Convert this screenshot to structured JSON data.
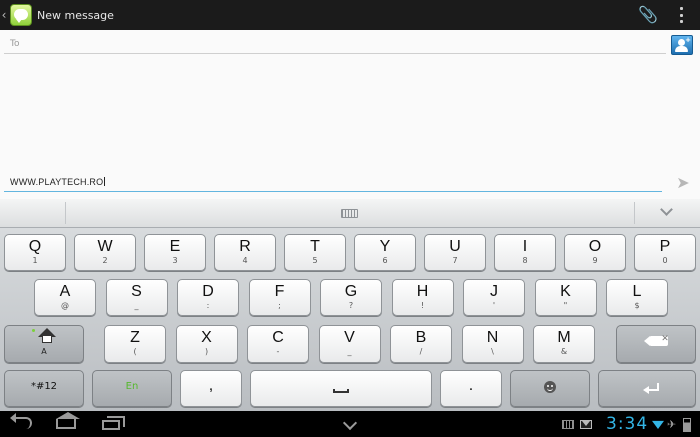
{
  "actionbar": {
    "title": "New message",
    "back_glyph": "‹",
    "app_icon": "messaging-app-icon",
    "attach_icon": "paperclip-icon",
    "overflow_icon": "overflow-menu-icon"
  },
  "compose": {
    "to_placeholder": "To",
    "message_text": "WWW.PLAYTECH.RO",
    "contact_icon": "add-contact-icon",
    "send_icon": "send-icon",
    "accent": "#63b5df"
  },
  "keyboard": {
    "row1": [
      {
        "k": "Q",
        "s": "1"
      },
      {
        "k": "W",
        "s": "2"
      },
      {
        "k": "E",
        "s": "3"
      },
      {
        "k": "R",
        "s": "4"
      },
      {
        "k": "T",
        "s": "5"
      },
      {
        "k": "Y",
        "s": "6"
      },
      {
        "k": "U",
        "s": "7"
      },
      {
        "k": "I",
        "s": "8"
      },
      {
        "k": "O",
        "s": "9"
      },
      {
        "k": "P",
        "s": "0"
      }
    ],
    "row2": [
      {
        "k": "A",
        "s": "@"
      },
      {
        "k": "S",
        "s": "_"
      },
      {
        "k": "D",
        "s": ":"
      },
      {
        "k": "F",
        "s": ";"
      },
      {
        "k": "G",
        "s": "?"
      },
      {
        "k": "H",
        "s": "!"
      },
      {
        "k": "J",
        "s": "'"
      },
      {
        "k": "K",
        "s": "\""
      },
      {
        "k": "L",
        "s": "$"
      }
    ],
    "row3": [
      {
        "k": "Z",
        "s": "("
      },
      {
        "k": "X",
        "s": ")"
      },
      {
        "k": "C",
        "s": "-"
      },
      {
        "k": "V",
        "s": "_"
      },
      {
        "k": "B",
        "s": "/"
      },
      {
        "k": "N",
        "s": "\\"
      },
      {
        "k": "M",
        "s": "&"
      }
    ],
    "shift_sub": "A",
    "symbols_label": "*#12",
    "language_label": "En",
    "comma": ",",
    "period": ".",
    "delete_glyph": "✕",
    "language_color": "#56b82e"
  },
  "statusbar": {
    "clock": "3:34",
    "clock_color": "#33b5e5",
    "plane_glyph": "✈"
  }
}
